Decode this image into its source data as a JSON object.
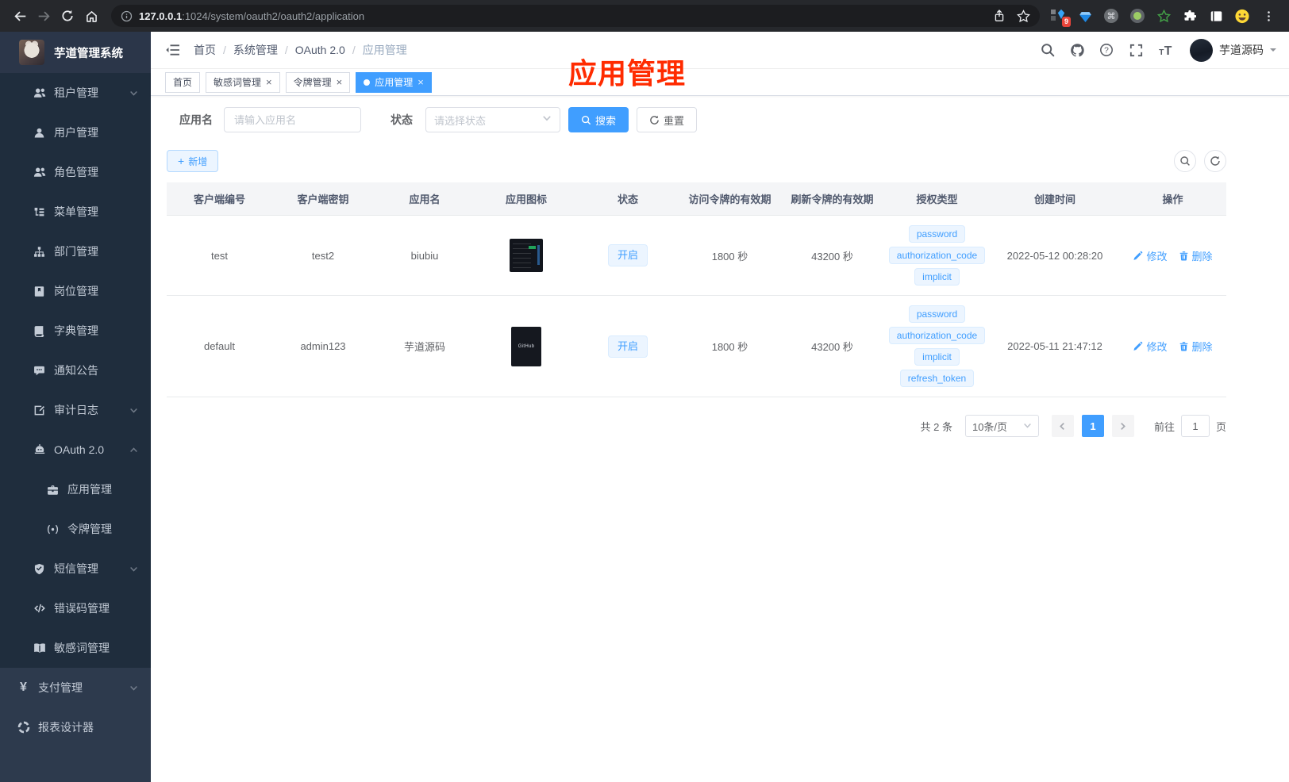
{
  "browser": {
    "url_host": "127.0.0.1",
    "url_rest": ":1024/system/oauth2/oauth2/application",
    "ext_badge": "9"
  },
  "sidebar": {
    "logo_title": "芋道管理系统",
    "menu": [
      {
        "label": "租户管理",
        "icon": "users",
        "level": "lv2",
        "dark": true,
        "chevron": "down"
      },
      {
        "label": "用户管理",
        "icon": "user",
        "level": "lv2",
        "dark": true
      },
      {
        "label": "角色管理",
        "icon": "users",
        "level": "lv2",
        "dark": true
      },
      {
        "label": "菜单管理",
        "icon": "tree",
        "level": "lv2",
        "dark": true
      },
      {
        "label": "部门管理",
        "icon": "org",
        "level": "lv2",
        "dark": true
      },
      {
        "label": "岗位管理",
        "icon": "badge",
        "level": "lv2",
        "dark": true
      },
      {
        "label": "字典管理",
        "icon": "book",
        "level": "lv2",
        "dark": true
      },
      {
        "label": "通知公告",
        "icon": "chat",
        "level": "lv2",
        "dark": true
      },
      {
        "label": "审计日志",
        "icon": "edit",
        "level": "lv2",
        "dark": true,
        "chevron": "down"
      },
      {
        "label": "OAuth 2.0",
        "icon": "robot",
        "level": "lv2",
        "dark": true,
        "chevron": "up"
      },
      {
        "label": "应用管理",
        "icon": "briefcase",
        "level": "lv3",
        "dark": true,
        "active": true
      },
      {
        "label": "令牌管理",
        "icon": "signal",
        "level": "lv3",
        "dark": true
      },
      {
        "label": "短信管理",
        "icon": "shield",
        "level": "lv2",
        "dark": true,
        "chevron": "down"
      },
      {
        "label": "错误码管理",
        "icon": "code",
        "level": "lv2",
        "dark": true
      },
      {
        "label": "敏感词管理",
        "icon": "openbook",
        "level": "lv2",
        "dark": true
      },
      {
        "label": "支付管理",
        "icon": "yen",
        "level": "lv1",
        "chevron": "down"
      },
      {
        "label": "报表设计器",
        "icon": "chart",
        "level": "lv1"
      }
    ]
  },
  "header": {
    "breadcrumb": [
      {
        "label": "首页",
        "sep": "/"
      },
      {
        "label": "系统管理",
        "sep": "/"
      },
      {
        "label": "OAuth 2.0",
        "sep": "/"
      },
      {
        "label": "应用管理",
        "muted": true
      }
    ],
    "username": "芋道源码"
  },
  "tabs": [
    {
      "label": "首页"
    },
    {
      "label": "敏感词管理",
      "closable": true
    },
    {
      "label": "令牌管理",
      "closable": true
    },
    {
      "label": "应用管理",
      "closable": true,
      "active": true
    }
  ],
  "annotation": {
    "text": "应用管理"
  },
  "filters": {
    "name_label": "应用名",
    "name_placeholder": "请输入应用名",
    "status_label": "状态",
    "status_placeholder": "请选择状态",
    "search": "搜索",
    "reset": "重置",
    "add": "新增"
  },
  "table": {
    "headers": [
      "客户端编号",
      "客户端密钥",
      "应用名",
      "应用图标",
      "状态",
      "访问令牌的有效期",
      "刷新令牌的有效期",
      "授权类型",
      "创建时间",
      "操作"
    ],
    "edit_label": "修改",
    "delete_label": "删除",
    "rows": [
      {
        "client_id": "test",
        "client_secret": "test2",
        "app_name": "biubiu",
        "icon_kind": "thumb-terminal",
        "icon_text": "",
        "status": "开启",
        "access": "1800 秒",
        "refresh": "43200 秒",
        "grants": [
          "password",
          "authorization_code",
          "implicit"
        ],
        "created": "2022-05-12 00:28:20"
      },
      {
        "client_id": "default",
        "client_secret": "admin123",
        "app_name": "芋道源码",
        "icon_kind": "thumb-github",
        "icon_text": "GitHub",
        "status": "开启",
        "access": "1800 秒",
        "refresh": "43200 秒",
        "grants": [
          "password",
          "authorization_code",
          "implicit",
          "refresh_token"
        ],
        "created": "2022-05-11 21:47:12"
      }
    ]
  },
  "pagination": {
    "total": "共 2 条",
    "page_size": "10条/页",
    "page": "1",
    "goto_label": "前往",
    "goto_page": "1",
    "page_unit": "页"
  }
}
